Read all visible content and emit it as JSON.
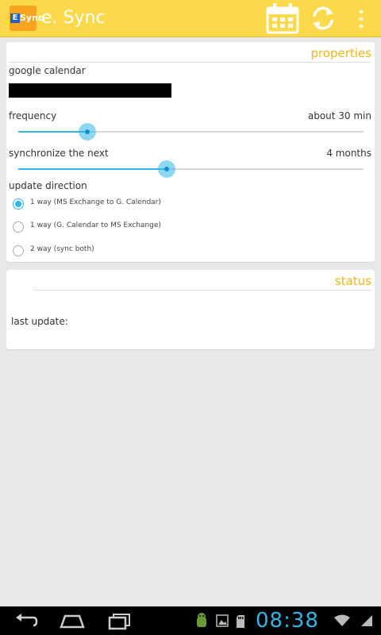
{
  "app": {
    "logo_text": "Sync",
    "title": "e. Sync"
  },
  "toolbar": {
    "icons": [
      "calendar-icon",
      "refresh-icon",
      "overflow-menu-icon"
    ]
  },
  "properties": {
    "section_title": "properties",
    "google_calendar_label": "google calendar",
    "frequency": {
      "label": "frequency",
      "value_text": "about 30 min",
      "position": 0.2
    },
    "sync_window": {
      "label": "synchronize the next",
      "value_text": "4 months",
      "position": 0.43
    },
    "update_direction": {
      "label": "update direction",
      "options": [
        {
          "label": "1 way (MS Exchange to G. Calendar)",
          "checked": true
        },
        {
          "label": "1 way (G. Calendar to MS Exchange)",
          "checked": false
        },
        {
          "label": "2 way (sync both)",
          "checked": false
        }
      ]
    }
  },
  "status": {
    "section_title": "status",
    "last_update_label": "last update:"
  },
  "system_bar": {
    "time": "08:38",
    "accent_color": "#33b5e5"
  }
}
